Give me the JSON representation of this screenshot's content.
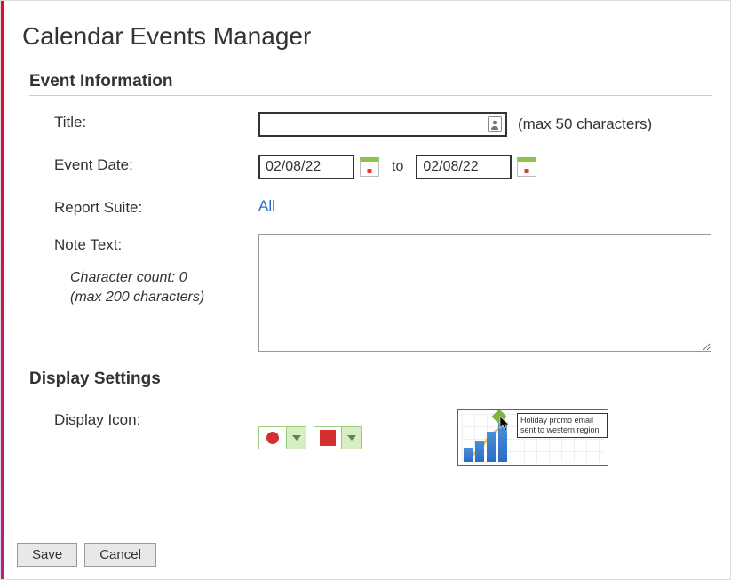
{
  "page_title": "Calendar Events Manager",
  "sections": {
    "info": "Event Information",
    "display": "Display Settings"
  },
  "form": {
    "title_label": "Title:",
    "title_value": "",
    "title_hint": "(max 50 characters)",
    "event_date_label": "Event Date:",
    "date_from": "02/08/22",
    "date_to": "02/08/22",
    "to_text": "to",
    "report_suite_label": "Report Suite:",
    "report_suite_value": "All",
    "note_label": "Note Text:",
    "note_value": "",
    "char_count_line1": "Character count: 0",
    "char_count_line2": "(max 200 characters)",
    "display_icon_label": "Display Icon:"
  },
  "shape_picker": {
    "color": "#d62f2f"
  },
  "color_picker": {
    "color": "#d62f2f"
  },
  "preview": {
    "tooltip_text": "Holiday promo email sent to western region"
  },
  "buttons": {
    "save": "Save",
    "cancel": "Cancel"
  }
}
